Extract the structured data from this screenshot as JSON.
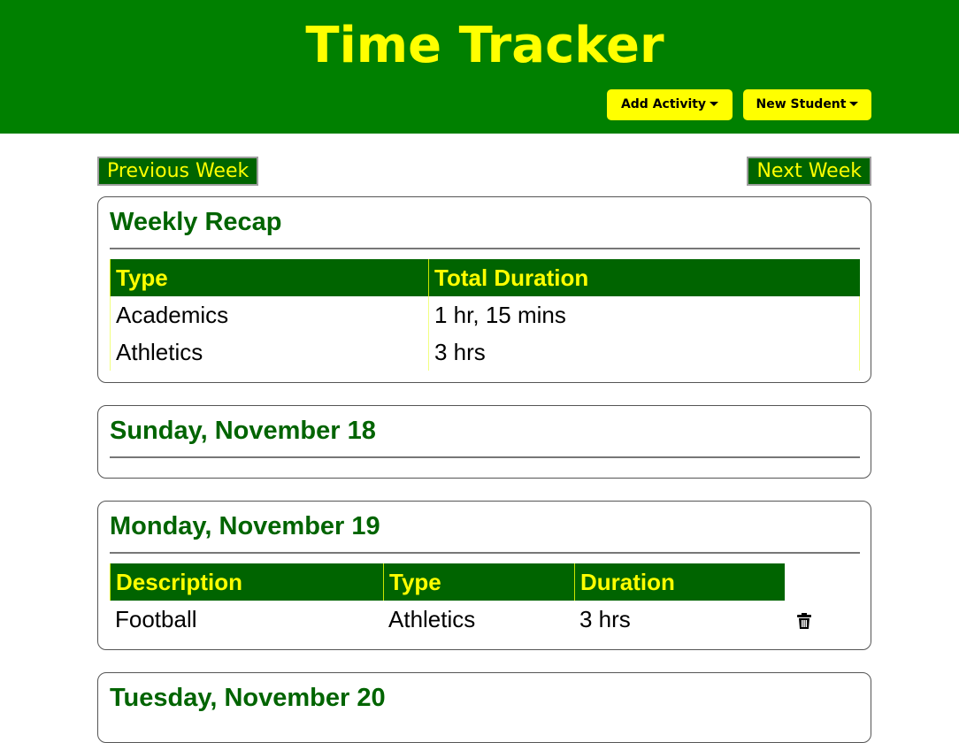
{
  "header": {
    "title": "Time Tracker",
    "add_activity_label": "Add Activity",
    "new_student_label": "New Student",
    "bg_color": "#008000",
    "accent_color": "#ffff00"
  },
  "nav": {
    "previous_week_label": "Previous Week",
    "next_week_label": "Next Week"
  },
  "weekly_recap": {
    "title": "Weekly Recap",
    "columns": [
      "Type",
      "Total Duration"
    ],
    "rows": [
      [
        "Academics",
        "1 hr, 15 mins"
      ],
      [
        "Athletics",
        "3 hrs"
      ]
    ]
  },
  "days": [
    {
      "title": "Sunday, November 18",
      "columns": [],
      "rows": []
    },
    {
      "title": "Monday, November 19",
      "columns": [
        "Description",
        "Type",
        "Duration"
      ],
      "rows": [
        [
          "Football",
          "Athletics",
          "3 hrs"
        ]
      ]
    },
    {
      "title": "Tuesday, November 20",
      "columns": [],
      "rows": []
    }
  ],
  "icons": {
    "dropdown": "caret-down-icon",
    "delete": "trash-icon"
  }
}
